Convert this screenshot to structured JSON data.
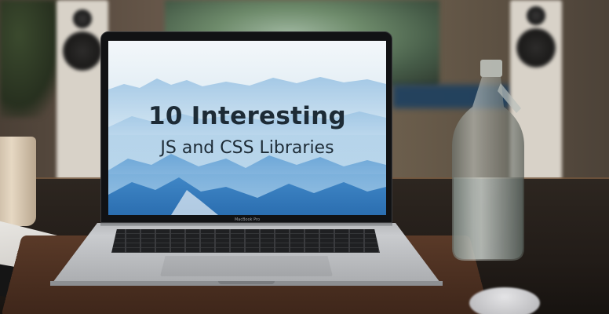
{
  "screen": {
    "headline": "10 Interesting",
    "subheadline": "JS and CSS Libraries",
    "bezel_label": "MacBook Pro"
  },
  "colors": {
    "headline_text": "#1d2b36",
    "sky_light": "#f3f7fa",
    "mountain_blue": "#3c86c4",
    "table_wood": "#2d2620"
  }
}
